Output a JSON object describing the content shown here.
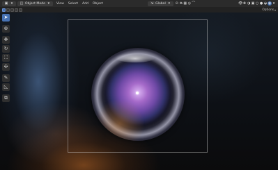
{
  "header": {
    "editor_type_icon": "3d-viewport-icon",
    "mode_label": "Object Mode",
    "menus": [
      "View",
      "Select",
      "Add",
      "Object"
    ],
    "orientation_label": "Global"
  },
  "subheader": {
    "options_label": "Options"
  },
  "toolbar": {
    "tools": [
      {
        "name": "select-tool",
        "icon": "cursor-icon",
        "glyph": "➤",
        "active": true
      },
      {
        "name": "cursor-tool",
        "icon": "3d-cursor-icon",
        "glyph": "⊕"
      },
      {
        "name": "move-tool",
        "icon": "move-icon",
        "glyph": "✥"
      },
      {
        "name": "rotate-tool",
        "icon": "rotate-icon",
        "glyph": "↻"
      },
      {
        "name": "scale-tool",
        "icon": "scale-icon",
        "glyph": "⛶"
      },
      {
        "name": "transform-tool",
        "icon": "transform-icon",
        "glyph": "✣"
      },
      {
        "name": "annotate-tool",
        "icon": "annotate-icon",
        "glyph": "✎"
      },
      {
        "name": "measure-tool",
        "icon": "measure-icon",
        "glyph": "◺"
      },
      {
        "name": "add-cube-tool",
        "icon": "add-cube-icon",
        "glyph": "⧉"
      }
    ]
  },
  "colors": {
    "accent": "#4772b3",
    "header_bg": "#2b2b2b"
  }
}
